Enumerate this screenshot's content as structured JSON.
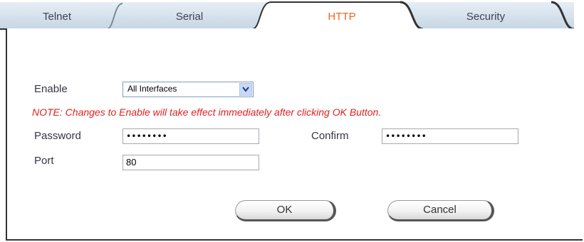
{
  "tabs": [
    {
      "label": "Telnet",
      "active": false
    },
    {
      "label": "Serial",
      "active": false
    },
    {
      "label": "HTTP",
      "active": true
    },
    {
      "label": "Security",
      "active": false
    }
  ],
  "form": {
    "enable_label": "Enable",
    "enable_value": "All Interfaces",
    "note": "NOTE: Changes to Enable will take effect immediately after clicking OK Button.",
    "password_label": "Password",
    "password_value": "••••••••",
    "confirm_label": "Confirm",
    "confirm_value": "••••••••",
    "port_label": "Port",
    "port_value": "80"
  },
  "buttons": {
    "ok_label": "OK",
    "cancel_label": "Cancel"
  },
  "colors": {
    "active_tab_text": "#ee6622",
    "note_text": "#e3201f",
    "inactive_tab_fill": "#d5e2ed"
  }
}
